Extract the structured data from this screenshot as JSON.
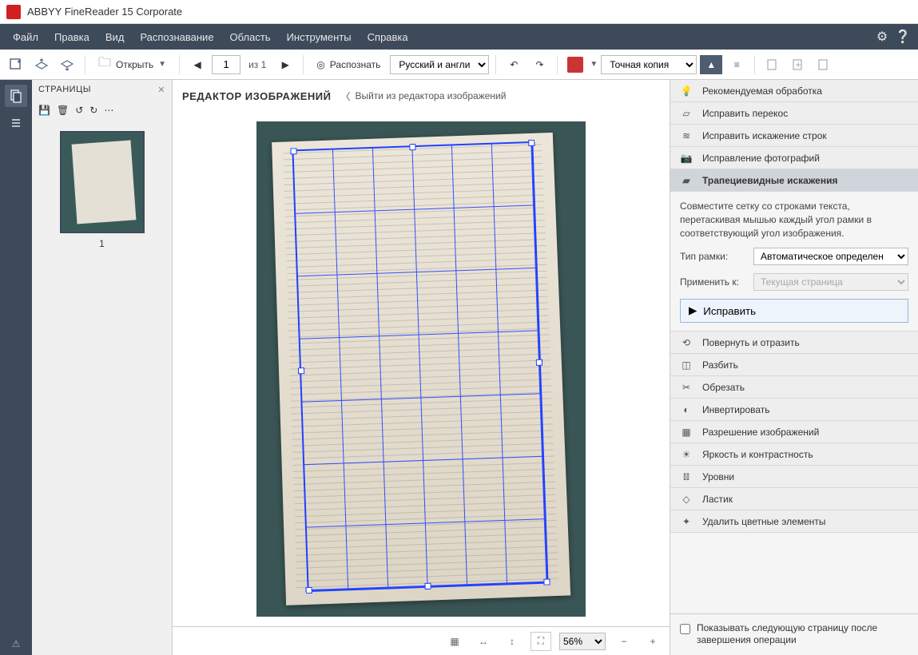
{
  "app": {
    "title": "ABBYY FineReader 15 Corporate"
  },
  "menu": {
    "file": "Файл",
    "edit": "Правка",
    "view": "Вид",
    "recognize": "Распознавание",
    "region": "Область",
    "tools": "Инструменты",
    "help": "Справка"
  },
  "toolbar": {
    "open": "Открыть",
    "page_value": "1",
    "page_of": "из 1",
    "recognize": "Распознать",
    "lang": "Русский и англи",
    "mode": "Точная копия"
  },
  "pages": {
    "title": "СТРАНИЦЫ",
    "thumb_number": "1"
  },
  "editor": {
    "title": "РЕДАКТОР ИЗОБРАЖЕНИЙ",
    "back": "Выйти из редактора изображений",
    "zoom": "56%"
  },
  "right": {
    "tools": [
      "Рекомендуемая обработка",
      "Исправить перекос",
      "Исправить искажение строк",
      "Исправление фотографий",
      "Трапециевидные искажения",
      "Повернуть и отразить",
      "Разбить",
      "Обрезать",
      "Инвертировать",
      "Разрешение изображений",
      "Яркость и контрастность",
      "Уровни",
      "Ластик",
      "Удалить цветные элементы"
    ],
    "selected_index": 4,
    "trap": {
      "hint": "Совместите сетку со строками текста, перетаскивая мышью каждый угол рамки в соответствующий угол изображения.",
      "frame_type_label": "Тип рамки:",
      "frame_type_value": "Автоматическое определен",
      "apply_to_label": "Применить к:",
      "apply_to_value": "Текущая страница",
      "apply_btn": "Исправить"
    },
    "footer_checkbox": "Показывать следующую страницу после завершения операции"
  }
}
